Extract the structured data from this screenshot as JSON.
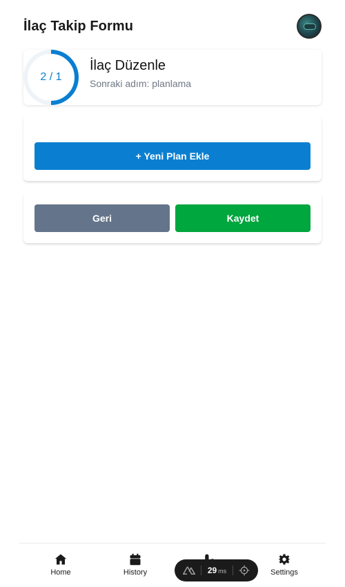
{
  "header": {
    "title": "İlaç Takip Formu",
    "avatar_icon": "user-avatar"
  },
  "step": {
    "progress_text": "2 / 1",
    "progress_fraction": 0.5,
    "accent_color": "#0a7fd1",
    "title": "İlaç Düzenle",
    "subtitle": "Sonraki adım: planlama"
  },
  "plan": {
    "add_label": "+ Yeni Plan Ekle",
    "add_color": "#0a7fd1"
  },
  "actions": {
    "back_label": "Geri",
    "back_color": "#64748b",
    "save_label": "Kaydet",
    "save_color": "#00a63e"
  },
  "nav": {
    "items": [
      {
        "label": "Home",
        "icon": "home-icon"
      },
      {
        "label": "History",
        "icon": "calendar-icon"
      },
      {
        "label": "",
        "icon": "pills-icon"
      },
      {
        "label": "Settings",
        "icon": "gear-icon"
      }
    ]
  },
  "dev_overlay": {
    "logo_icon": "nuxt-logo-icon",
    "value": "29",
    "unit": "ms",
    "target_icon": "crosshair-icon"
  }
}
